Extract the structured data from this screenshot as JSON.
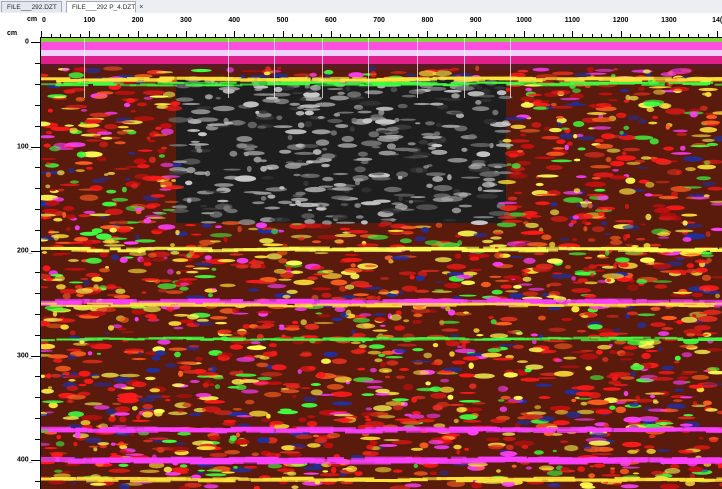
{
  "tabs": [
    {
      "label": "FILE___292.DZT",
      "active": false
    },
    {
      "label": "FILE___292 P_4.DZT",
      "active": true,
      "close": "×"
    }
  ],
  "axes": {
    "x_unit": "cm",
    "y_unit": "cm",
    "x_ticks": [
      "0",
      "100",
      "200",
      "300",
      "400",
      "500",
      "600",
      "700",
      "800",
      "900",
      "1000",
      "1100",
      "1200",
      "1300",
      "14("
    ],
    "y_ticks": [
      "0",
      "100_",
      "200_",
      "300_",
      "400_"
    ]
  },
  "radargram": {
    "description_colors": [
      "#ff1a1a",
      "#ffff33",
      "#33ff33",
      "#ff33ff",
      "#2233aa",
      "#1a1a1a",
      "#8a8a8a"
    ],
    "bands": [
      "surface",
      "dark_void",
      "reflector_260",
      "deep_noise"
    ]
  }
}
